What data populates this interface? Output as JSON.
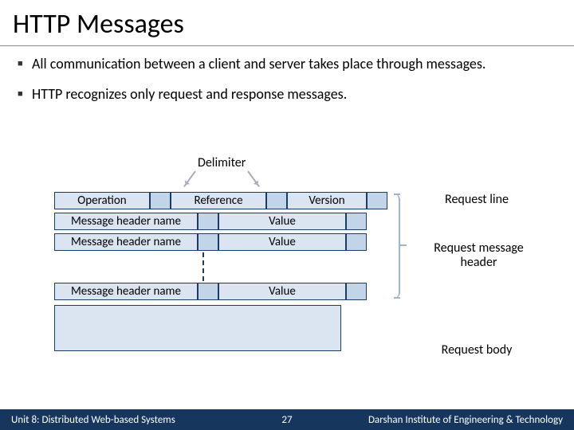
{
  "title": "HTTP Messages",
  "bullets": [
    "All communication between a client and server takes place through messages.",
    "HTTP recognizes only request and response messages."
  ],
  "diagram": {
    "delimiter_label": "Delimiter",
    "request_line": {
      "operation": "Operation",
      "reference": "Reference",
      "version": "Version"
    },
    "headers": [
      {
        "name": "Message header name",
        "value": "Value"
      },
      {
        "name": "Message header name",
        "value": "Value"
      },
      {
        "name": "Message header name",
        "value": "Value"
      }
    ],
    "right_labels": {
      "line": "Request line",
      "header": "Request message header",
      "body": "Request body"
    }
  },
  "footer": {
    "left": "Unit 8: Distributed Web-based Systems",
    "page": "27",
    "right": "Darshan Institute of Engineering & Technology"
  }
}
